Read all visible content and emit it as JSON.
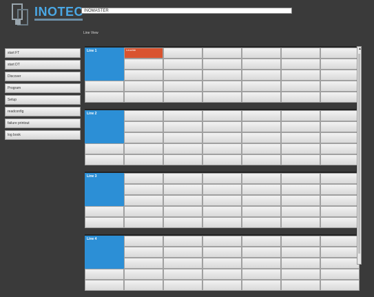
{
  "header": {
    "brand": "INOTEC",
    "title_field": "INOMASTER",
    "view_label": "Line View"
  },
  "sidebar": {
    "items": [
      {
        "label": "start FT"
      },
      {
        "label": "start DT"
      },
      {
        "label": "Discover"
      },
      {
        "label": "Program"
      },
      {
        "label": "Setup"
      },
      {
        "label": "readconfig"
      },
      {
        "label": "failure printout"
      },
      {
        "label": "log book"
      }
    ]
  },
  "lines": [
    {
      "label": "Line 1",
      "alert_cell": "Leuchte"
    },
    {
      "label": "Line 2"
    },
    {
      "label": "Line 3"
    },
    {
      "label": "Line 4"
    }
  ],
  "colors": {
    "accent": "#2c8fd6",
    "alert": "#d9532f",
    "background": "#3a3a3a",
    "brand": "#4aa7e4"
  }
}
